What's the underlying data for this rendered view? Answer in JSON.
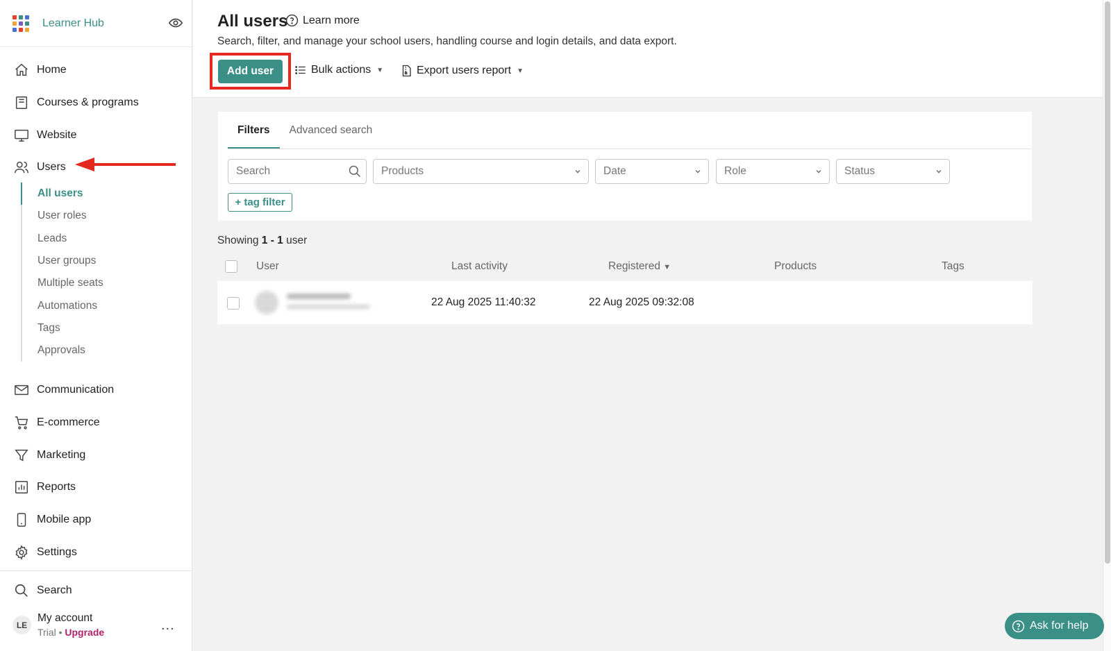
{
  "brand": {
    "name": "Learner Hub",
    "logo_colors": [
      "#e5402e",
      "#3a8f86",
      "#4a6fd0",
      "#f2a33a",
      "#7a5bc0",
      "#3a8f86",
      "#4a6fd0",
      "#e5402e",
      "#f2a33a"
    ]
  },
  "nav": {
    "home": "Home",
    "courses": "Courses & programs",
    "website": "Website",
    "users": "Users",
    "communication": "Communication",
    "ecommerce": "E-commerce",
    "marketing": "Marketing",
    "reports": "Reports",
    "mobile": "Mobile app",
    "settings": "Settings",
    "search": "Search"
  },
  "subnav": {
    "all_users": "All users",
    "user_roles": "User roles",
    "leads": "Leads",
    "user_groups": "User groups",
    "multiple_seats": "Multiple seats",
    "automations": "Automations",
    "tags": "Tags",
    "approvals": "Approvals"
  },
  "account": {
    "initials": "LE",
    "name": "My account",
    "plan": "Trial",
    "separator": " • ",
    "upgrade": "Upgrade",
    "more": "..."
  },
  "header": {
    "title": "All users",
    "learn_more": "Learn more",
    "subtitle": "Search, filter, and manage your school users, handling course and login details, and data export.",
    "add_user": "Add user",
    "bulk_actions": "Bulk actions",
    "export_report": "Export users report"
  },
  "filters": {
    "tab_filters": "Filters",
    "tab_advanced": "Advanced search",
    "search_placeholder": "Search",
    "products": "Products",
    "date": "Date",
    "role": "Role",
    "status": "Status",
    "tag_filter": "+ tag filter"
  },
  "results": {
    "showing_prefix": "Showing ",
    "range": "1 - 1",
    "showing_suffix": " user",
    "columns": {
      "user": "User",
      "last_activity": "Last activity",
      "registered": "Registered",
      "products": "Products",
      "tags": "Tags"
    },
    "sort_indicator": "▼",
    "rows": [
      {
        "last_activity": "22 Aug 2025 11:40:32",
        "registered": "22 Aug 2025 09:32:08"
      }
    ]
  },
  "help": {
    "label": "Ask for help"
  },
  "colors": {
    "accent": "#3a8f86",
    "highlight": "#e5281d",
    "upgrade": "#b0236c"
  }
}
